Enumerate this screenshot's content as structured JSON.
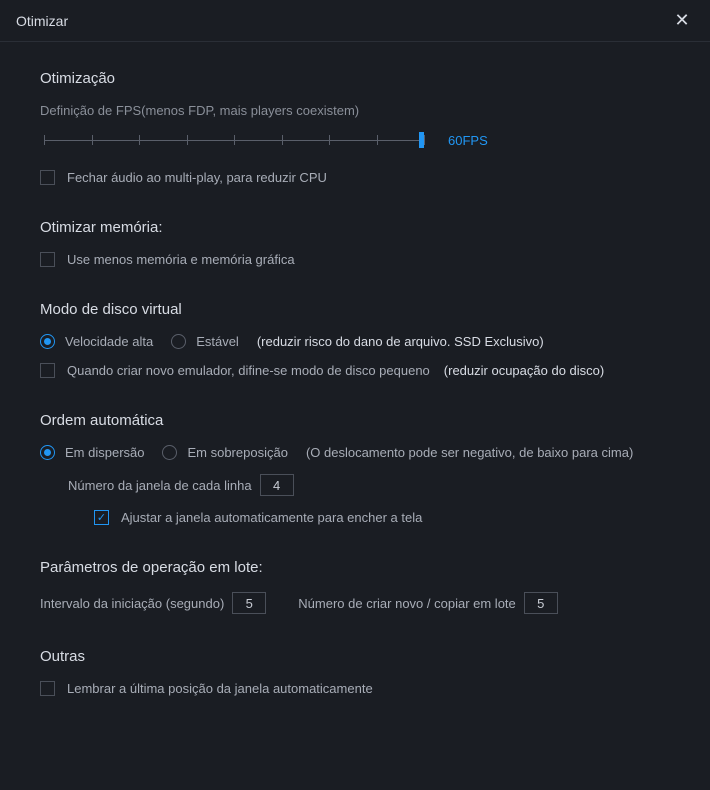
{
  "titlebar": {
    "title": "Otimizar"
  },
  "optimization": {
    "heading": "Otimização",
    "fps_label": "Definição de FPS(menos FDP, mais players coexistem)",
    "fps_value": "60FPS",
    "close_audio": "Fechar áudio ao multi-play, para reduzir CPU"
  },
  "memory": {
    "heading": "Otimizar memória:",
    "use_less": "Use menos memória e memória gráfica"
  },
  "disk": {
    "heading": "Modo de disco virtual",
    "high_speed": "Velocidade alta",
    "stable": "Estável",
    "stable_note": "(reduzir risco do dano de arquivo. SSD Exclusivo)",
    "small_disk": "Quando criar novo emulador, difine-se modo de disco pequeno",
    "small_disk_note": "(reduzir ocupação do disco)"
  },
  "order": {
    "heading": "Ordem automática",
    "scatter": "Em dispersão",
    "overlap": "Em sobreposição",
    "overlap_note": "(O deslocamento pode ser negativo, de baixo para cima)",
    "windows_per_line": "Número da janela de cada linha",
    "windows_per_line_value": "4",
    "auto_fit": "Ajustar a janela automaticamente para encher a tela"
  },
  "batch": {
    "heading": "Parâmetros de operação em lote:",
    "interval_label": "Intervalo da iniciação (segundo)",
    "interval_value": "5",
    "count_label": "Número de criar novo / copiar em lote",
    "count_value": "5"
  },
  "other": {
    "heading": "Outras",
    "remember_pos": "Lembrar a última posição da janela automaticamente"
  }
}
